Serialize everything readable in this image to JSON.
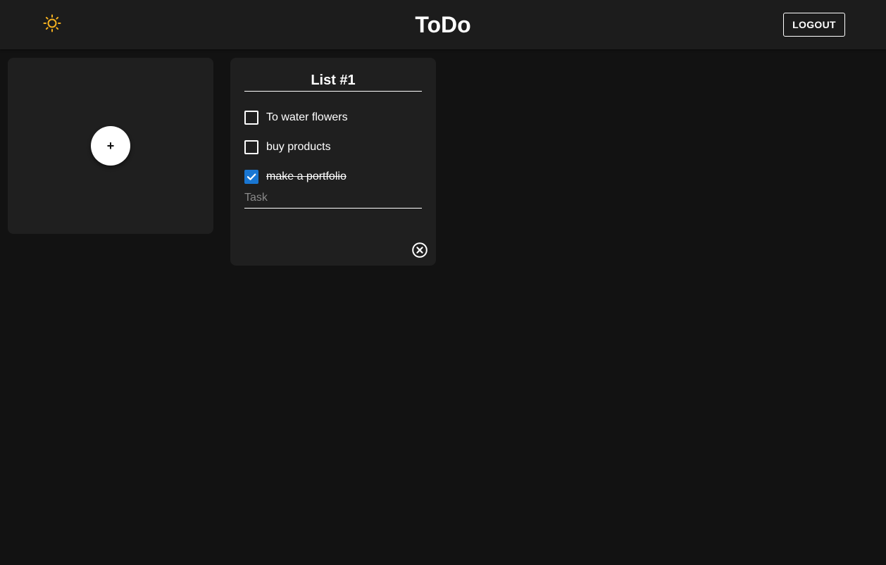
{
  "header": {
    "title": "ToDo",
    "logout_label": "LOGOUT",
    "theme_icon": "sun-icon",
    "theme_icon_color": "#f5b120"
  },
  "add_card": {
    "button_label": "+"
  },
  "lists": [
    {
      "title": "List #1",
      "tasks": [
        {
          "label": "To water flowers",
          "done": false
        },
        {
          "label": "buy products",
          "done": false
        },
        {
          "label": "make a portfolio",
          "done": true
        }
      ],
      "new_task_placeholder": "Task",
      "delete_icon": "close-circle-icon"
    }
  ],
  "colors": {
    "background": "#121212",
    "header": "#1c1c1c",
    "card": "#1f1f1f",
    "checkbox_accent": "#1976d2"
  }
}
